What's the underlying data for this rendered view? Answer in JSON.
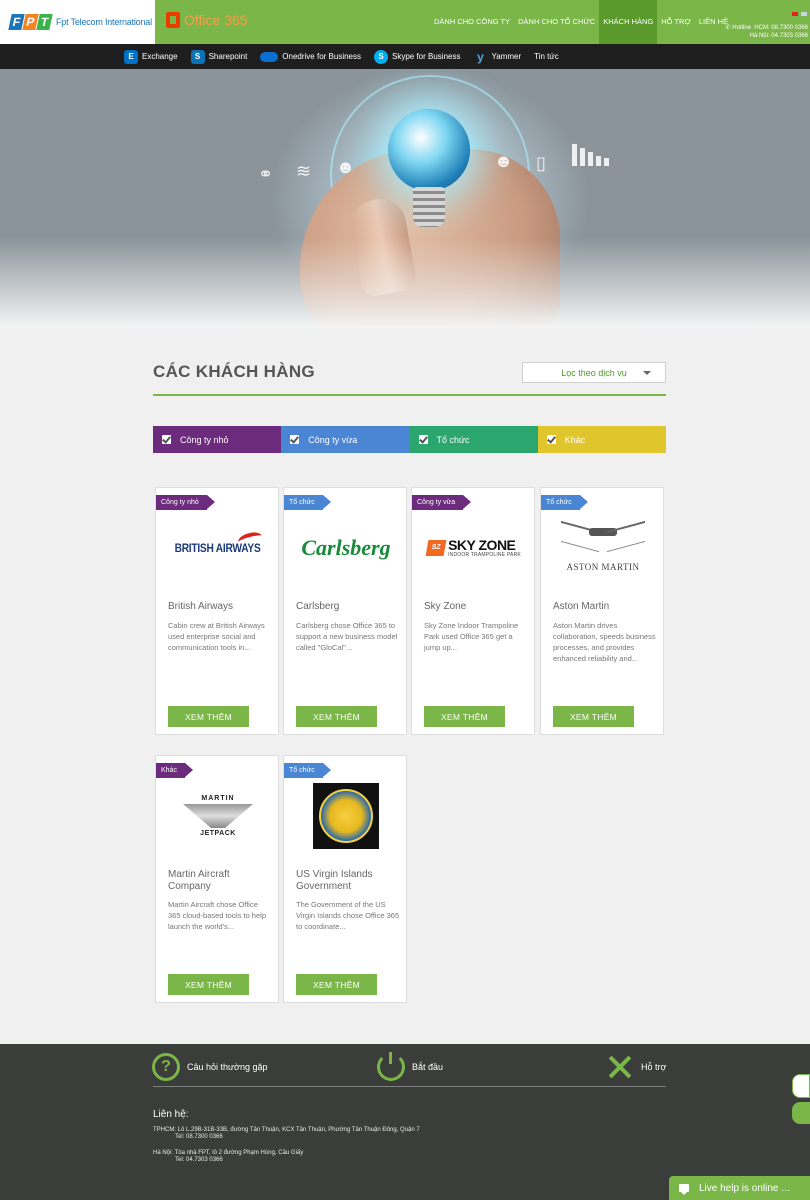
{
  "header": {
    "brand": "Fpt Telecom International",
    "fpt_letters": [
      "F",
      "P",
      "T"
    ],
    "product": "Office 365",
    "nav": [
      {
        "label": "DÀNH CHO CÔNG TY",
        "active": false
      },
      {
        "label": "DÀNH CHO TỔ CHỨC",
        "active": false
      },
      {
        "label": "KHÁCH HÀNG",
        "active": true
      },
      {
        "label": "HỖ TRỢ",
        "active": false
      },
      {
        "label": "LIÊN HỆ",
        "active": false
      }
    ],
    "hotline_label": "Hotline",
    "hotline_hcm": "HCM: 08.7300 0366",
    "hotline_hn": "Hà Nội: 04.7303 0366"
  },
  "subnav": [
    {
      "label": "Exchange",
      "icon": "exchange-icon",
      "glyph": "E"
    },
    {
      "label": "Sharepoint",
      "icon": "sharepoint-icon",
      "glyph": "S"
    },
    {
      "label": "Onedrive for Business",
      "icon": "onedrive-icon",
      "glyph": ""
    },
    {
      "label": "Skype for Business",
      "icon": "skype-icon",
      "glyph": "S"
    },
    {
      "label": "Yammer",
      "icon": "yammer-icon",
      "glyph": "y"
    },
    {
      "label": "Tin tức",
      "icon": "",
      "glyph": ""
    }
  ],
  "main": {
    "title": "CÁC KHÁCH HÀNG",
    "filter_label": "Lọc theo dịch vụ",
    "categories": [
      {
        "label": "Công ty nhỏ",
        "color": "#6c2b7c"
      },
      {
        "label": "Công ty vừa",
        "color": "#4a86d4"
      },
      {
        "label": "Tổ chức",
        "color": "#2aa66e"
      },
      {
        "label": "Khác",
        "color": "#e0c52c"
      }
    ],
    "cards": [
      {
        "tag": "Công ty nhỏ",
        "tag_color": "purple",
        "title": "British Airways",
        "desc": "Cabin crew at British Airways used enterprise social and communication tools in...",
        "button": "XEM THÊM",
        "logo": "BRITISH AIRWAYS"
      },
      {
        "tag": "Tổ chức",
        "tag_color": "blue",
        "title": "Carlsberg",
        "desc": "Carlsberg chose Office 365 to support a new business model called \"GloCal\"...",
        "button": "XEM THÊM",
        "logo": "Carlsberg"
      },
      {
        "tag": "Công ty vừa",
        "tag_color": "purple",
        "title": "Sky Zone",
        "desc": "Sky Zone Indoor Trampoline Park used Office 365 get a jump up...",
        "button": "XEM THÊM",
        "logo": "SKY ZONE",
        "logo_sub": "INDOOR TRAMPOLINE PARK"
      },
      {
        "tag": "Tổ chức",
        "tag_color": "blue",
        "title": "Aston Martin",
        "desc": "Aston Martin drives collaboration, speeds business processes, and provides enhanced reliability and...",
        "button": "XEM THÊM",
        "logo": "ASTON MARTIN"
      },
      {
        "tag": "Khác",
        "tag_color": "purple",
        "title": "Martin Aircraft Company",
        "desc": "Martin Aircraft chose Office 365 cloud-based tools to help launch the world's...",
        "button": "XEM THÊM",
        "logo": "MARTIN",
        "logo_sub": "JETPACK"
      },
      {
        "tag": "Tổ chức",
        "tag_color": "blue",
        "title": "US Virgin Islands Government",
        "desc": "The Government of the US Virgin Islands chose Office 365 to coordinate...",
        "button": "XEM THÊM",
        "logo": ""
      }
    ]
  },
  "footer": {
    "faq": "Câu hỏi thường gặp",
    "start": "Bắt đầu",
    "support": "Hỗ trợ",
    "contact_title": "Liên hệ:",
    "hcm_address": "TPHCM: Lô L.29B-31B-33B, đường Tân Thuận, KCX Tân Thuận, Phường Tân Thuận Đông, Quận 7",
    "hcm_tel": "Tel: 08.7300 0366",
    "hn_address": "Hà Nội: Tòa nhà FPT, lô 2 đường Phạm Hùng, Cầu Giấy",
    "hn_tel": "Tel: 04.7303 0366",
    "live_help": "Live help is online ..."
  }
}
